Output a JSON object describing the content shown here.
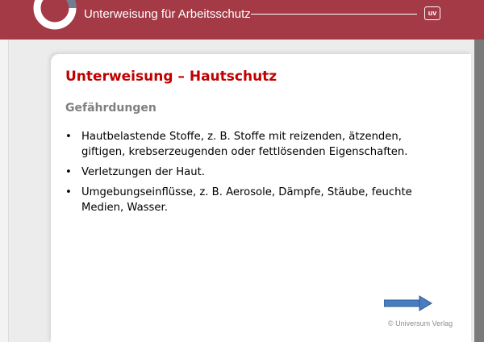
{
  "header": {
    "title": "Unterweisung für Arbeitsschutz",
    "badge": "uv"
  },
  "slide": {
    "title": "Unterweisung – Hautschutz",
    "section": "Gefährdungen",
    "bullets": [
      "Hautbelastende Stoffe, z. B. Stoffe mit reizenden, ätzenden, giftigen, krebserzeugenden oder fettlösenden Eigenschaften.",
      "Verletzungen der Haut.",
      "Umgebungseinflüsse, z. B. Aerosole, Dämpfe, Stäube, feuchte Medien, Wasser."
    ]
  },
  "footer": {
    "copyright": "© Universum Verlag",
    "next_icon": "right-arrow-icon"
  },
  "colors": {
    "header_bg": "#a33a45",
    "title_red": "#c00000",
    "arrow_blue": "#4a7cc0"
  }
}
